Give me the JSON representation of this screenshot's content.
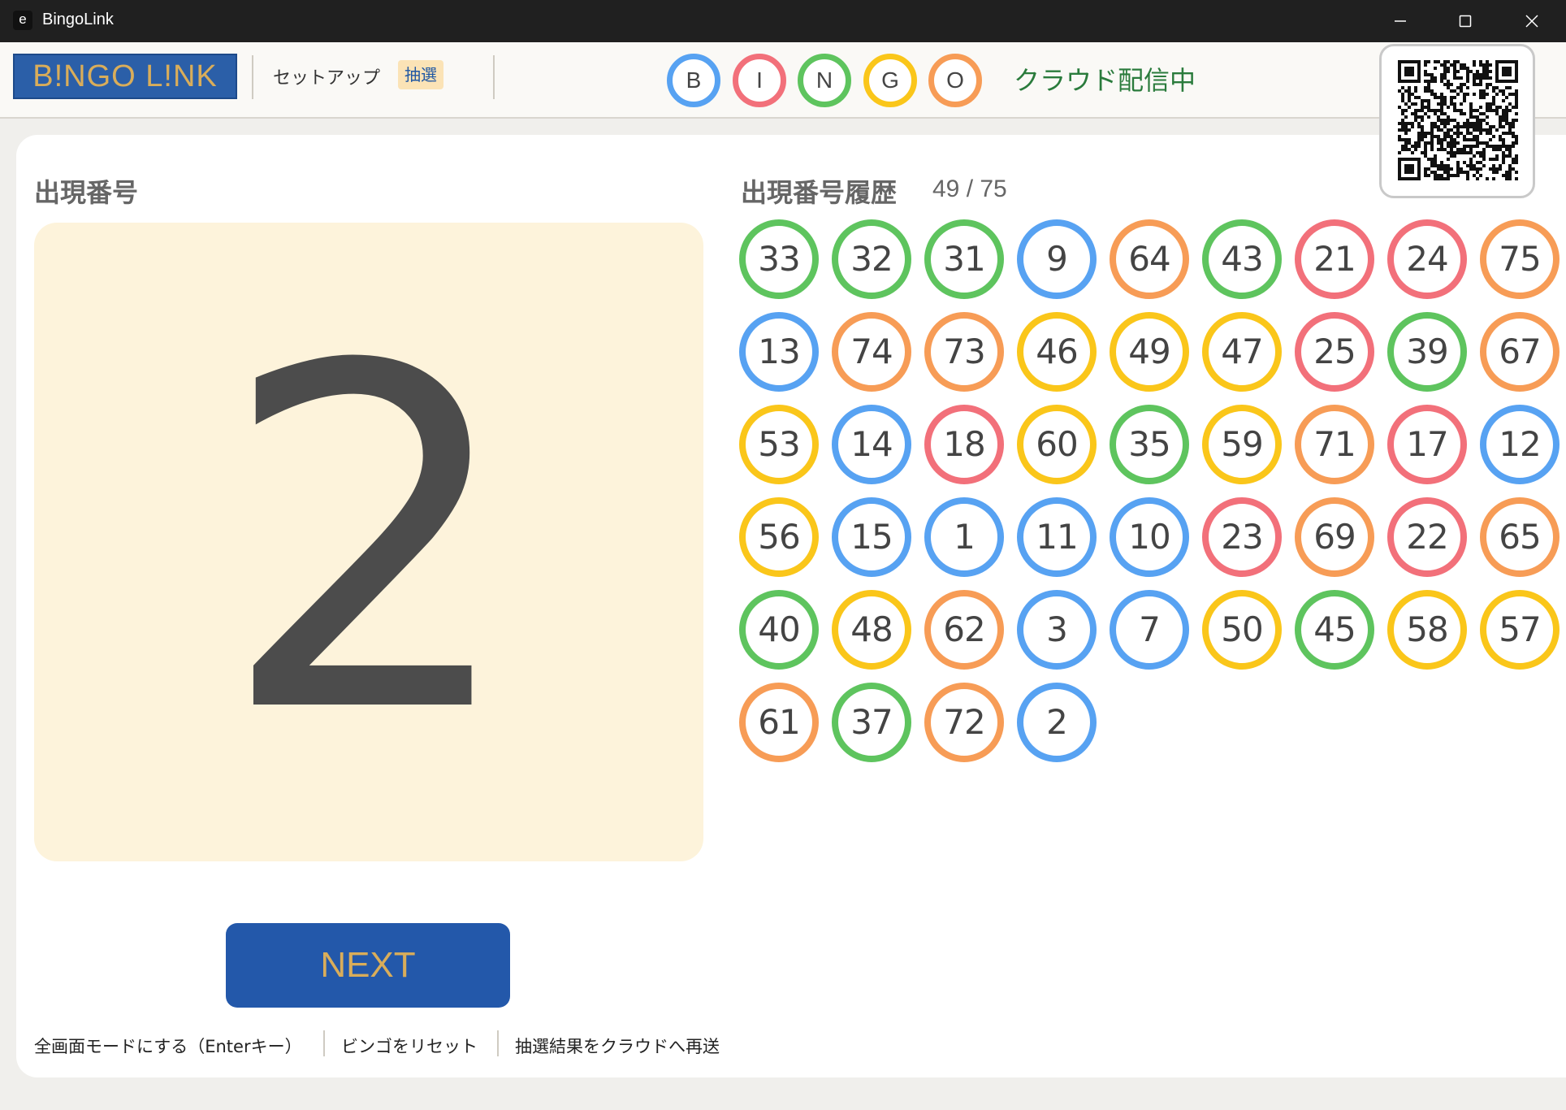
{
  "window": {
    "title": "BingoLink",
    "icon_letter": "e"
  },
  "header": {
    "logo": "B!NGO L!NK",
    "nav_setup": "セットアップ",
    "nav_draw": "抽選",
    "bingo_letters": [
      "B",
      "I",
      "N",
      "G",
      "O"
    ],
    "letter_colors": [
      "#57a2f2",
      "#f2707a",
      "#5ec45e",
      "#fac61a",
      "#f79c56"
    ],
    "cloud_status": "クラウド配信中"
  },
  "current": {
    "title": "出現番号",
    "number": "2"
  },
  "history": {
    "title": "出現番号履歴",
    "count": "49 / 75",
    "numbers": [
      "33",
      "32",
      "31",
      "9",
      "64",
      "43",
      "21",
      "24",
      "75",
      "13",
      "74",
      "73",
      "46",
      "49",
      "47",
      "25",
      "39",
      "67",
      "53",
      "14",
      "18",
      "60",
      "35",
      "59",
      "71",
      "17",
      "12",
      "56",
      "15",
      "1",
      "11",
      "10",
      "23",
      "69",
      "22",
      "65",
      "40",
      "48",
      "62",
      "3",
      "7",
      "50",
      "45",
      "58",
      "57",
      "61",
      "37",
      "72",
      "2"
    ]
  },
  "next_button": "NEXT",
  "footer": {
    "fullscreen": "全画面モードにする（Enterキー）",
    "reset": "ビンゴをリセット",
    "resend": "抽選結果をクラウドへ再送"
  }
}
